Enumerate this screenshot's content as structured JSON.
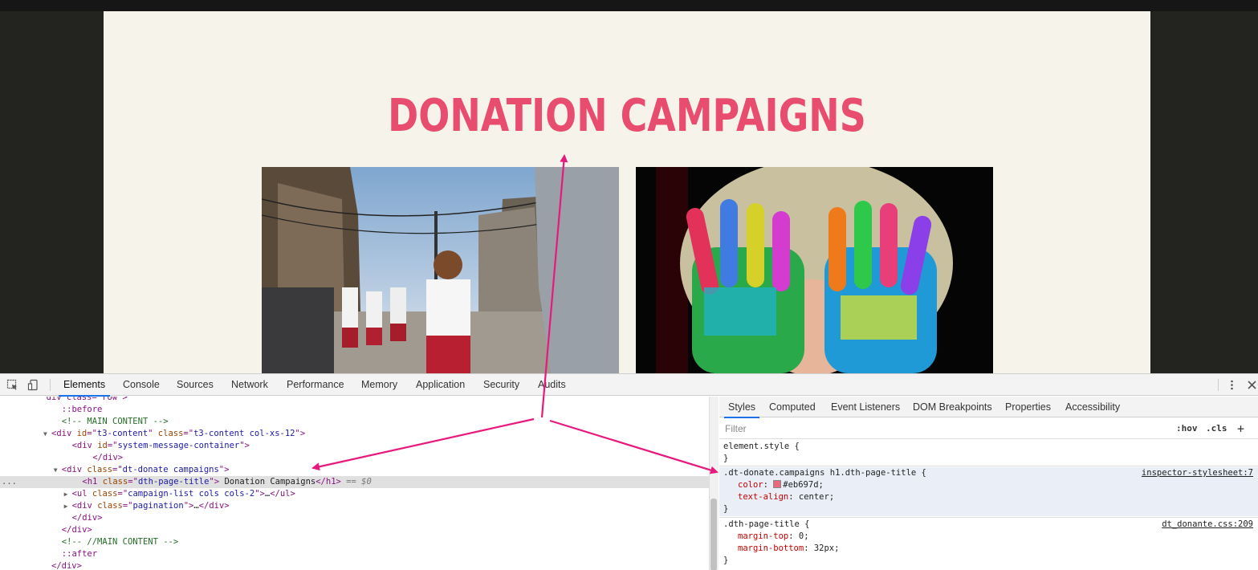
{
  "page": {
    "title": "DONATION CAMPAIGNS",
    "title_color": "#e84c6e"
  },
  "devtools": {
    "tabs": [
      "Elements",
      "Console",
      "Sources",
      "Network",
      "Performance",
      "Memory",
      "Application",
      "Security",
      "Audits"
    ],
    "active_tab": "Elements",
    "elements": {
      "lines": [
        {
          "indent": 9,
          "parts": [
            [
              "tag",
              "div class=\"row\">"
            ]
          ]
        },
        {
          "indent": 12,
          "parts": [
            [
              "ps",
              "::before"
            ]
          ]
        },
        {
          "indent": 12,
          "parts": [
            [
              "cm",
              "<!-- MAIN CONTENT -->"
            ]
          ]
        },
        {
          "indent": 10,
          "tri": "down",
          "parts": [
            [
              "tag",
              "<div "
            ],
            [
              "an",
              "id"
            ],
            [
              "tag",
              "=\""
            ],
            [
              "av",
              "t3-content"
            ],
            [
              "tag",
              "\" "
            ],
            [
              "an",
              "class"
            ],
            [
              "tag",
              "=\""
            ],
            [
              "av",
              "t3-content col-xs-12"
            ],
            [
              "tag",
              "\">"
            ]
          ]
        },
        {
          "indent": 14,
          "parts": [
            [
              "tag",
              "<div "
            ],
            [
              "an",
              "id"
            ],
            [
              "tag",
              "=\""
            ],
            [
              "av",
              "system-message-container"
            ],
            [
              "tag",
              "\">"
            ]
          ]
        },
        {
          "indent": 18,
          "parts": [
            [
              "tag",
              "</div>"
            ]
          ]
        },
        {
          "indent": 12,
          "tri": "down",
          "parts": [
            [
              "tag",
              "<div "
            ],
            [
              "an",
              "class"
            ],
            [
              "tag",
              "=\""
            ],
            [
              "av",
              "dt-donate campaigns"
            ],
            [
              "tag",
              "\">"
            ]
          ]
        },
        {
          "indent": 16,
          "sel": true,
          "parts": [
            [
              "tag",
              "<h1 "
            ],
            [
              "an",
              "class"
            ],
            [
              "tag",
              "=\""
            ],
            [
              "av",
              "dth-page-title"
            ],
            [
              "tag",
              "\">"
            ],
            [
              "txt",
              " Donation Campaigns"
            ],
            [
              "tag",
              "</h1>"
            ],
            [
              "dim",
              " == $0"
            ]
          ]
        },
        {
          "indent": 14,
          "tri": "right",
          "parts": [
            [
              "tag",
              "<ul "
            ],
            [
              "an",
              "class"
            ],
            [
              "tag",
              "=\""
            ],
            [
              "av",
              "campaign-list cols cols-2"
            ],
            [
              "tag",
              "\">"
            ],
            [
              "txt",
              "…"
            ],
            [
              "tag",
              "</ul>"
            ]
          ]
        },
        {
          "indent": 14,
          "tri": "right",
          "parts": [
            [
              "tag",
              "<div "
            ],
            [
              "an",
              "class"
            ],
            [
              "tag",
              "=\""
            ],
            [
              "av",
              "pagination"
            ],
            [
              "tag",
              "\">"
            ],
            [
              "txt",
              "…"
            ],
            [
              "tag",
              "</div>"
            ]
          ]
        },
        {
          "indent": 14,
          "parts": [
            [
              "tag",
              "</div>"
            ]
          ]
        },
        {
          "indent": 12,
          "parts": [
            [
              "tag",
              "</div>"
            ]
          ]
        },
        {
          "indent": 12,
          "parts": [
            [
              "cm",
              "<!-- //MAIN CONTENT -->"
            ]
          ]
        },
        {
          "indent": 12,
          "parts": [
            [
              "ps",
              "::after"
            ]
          ]
        },
        {
          "indent": 10,
          "parts": [
            [
              "tag",
              "</div>"
            ]
          ]
        }
      ],
      "ellipsis": "..."
    },
    "styles": {
      "tabs": [
        "Styles",
        "Computed",
        "Event Listeners",
        "DOM Breakpoints",
        "Properties",
        "Accessibility"
      ],
      "active_tab": "Styles",
      "filter_placeholder": "Filter",
      "hov": ":hov",
      "cls": ".cls",
      "plus": "+",
      "element_style": "element.style {",
      "close_brace": "}",
      "rule1": {
        "selector": ".dt-donate.campaigns h1.dth-page-title {",
        "source": "inspector-stylesheet:7",
        "color_prop": "color",
        "color_value": "#eb697d",
        "color_hex": "#eb697d",
        "align_prop": "text-align",
        "align_value": "center"
      },
      "rule2": {
        "selector": ".dth-page-title {",
        "source": "dt_donante.css:209",
        "mt_prop": "margin-top",
        "mt_value": "0",
        "mb_prop": "margin-bottom",
        "mb_value": "32px"
      }
    }
  },
  "colors": {
    "arrow": "#e8197d",
    "accent": "#1a73e8"
  }
}
